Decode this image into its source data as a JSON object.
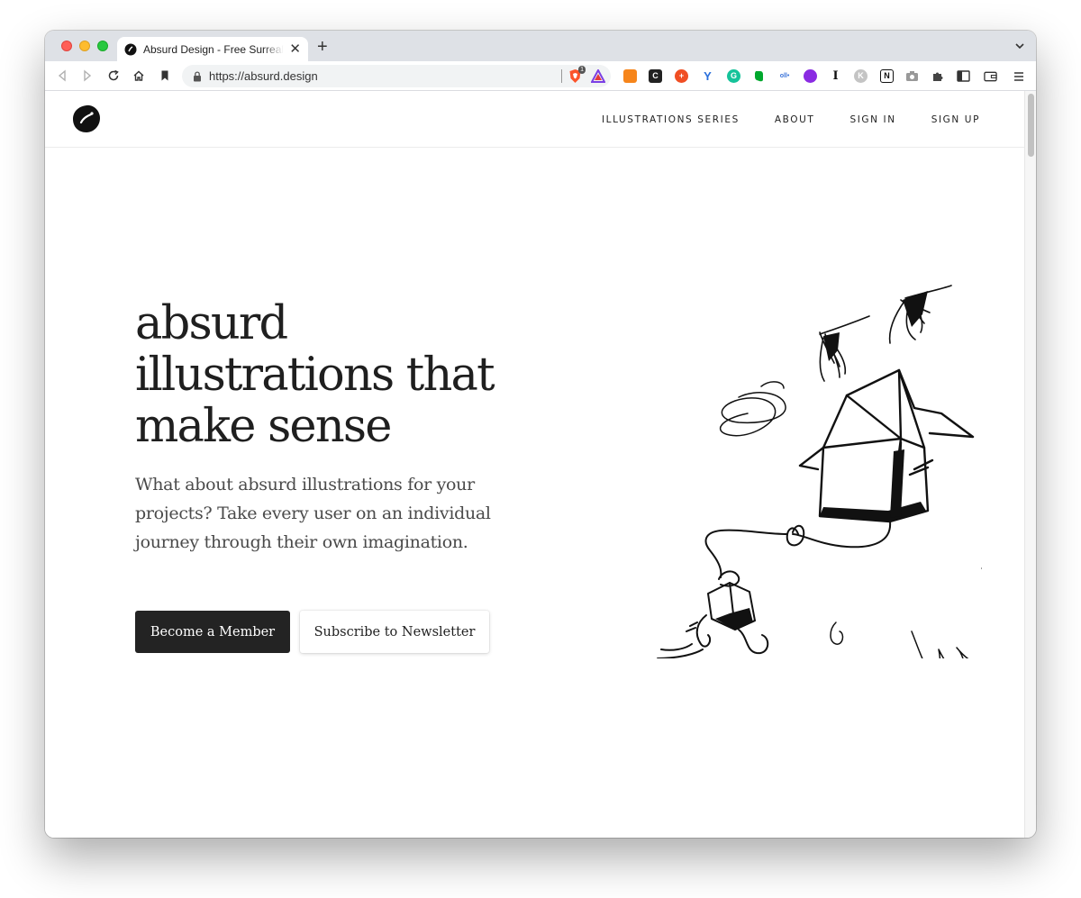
{
  "browser": {
    "tab_title": "Absurd Design - Free Surrealist Illustrations",
    "url": "https://absurd.design",
    "brave_badge_count": "1"
  },
  "site": {
    "nav": [
      {
        "label": "ILLUSTRATIONS SERIES"
      },
      {
        "label": "ABOUT"
      },
      {
        "label": "SIGN IN"
      },
      {
        "label": "SIGN UP"
      }
    ],
    "hero": {
      "title": "absurd illustrations that make sense",
      "text": "What about absurd illustrations for your projects? Take every user on an individual journey through their own imagination.",
      "primary_cta": "Become a Member",
      "secondary_cta": "Subscribe to Newsletter"
    }
  },
  "colors": {
    "tabstrip": "#dee1e6",
    "primary_button": "#232323",
    "heading": "#1f1f1f",
    "body_text": "#4a4a4a"
  },
  "icons": {
    "toolbar": [
      "back-icon",
      "forward-icon",
      "reload-icon",
      "home-icon",
      "bookmark-icon",
      "lock-icon"
    ],
    "extensions": [
      "brave-shield-icon",
      "brave-rewards-icon",
      "metamask-icon",
      "extension-c-icon",
      "extension-plus-icon",
      "extension-y-icon",
      "grammarly-icon",
      "evernote-icon",
      "extension-ob-icon",
      "extension-purple-icon",
      "instapaper-icon",
      "extension-k-icon",
      "notion-icon",
      "screenshot-icon",
      "puzzle-icon",
      "sidebar-icon",
      "wallet-icon",
      "menu-icon"
    ]
  }
}
